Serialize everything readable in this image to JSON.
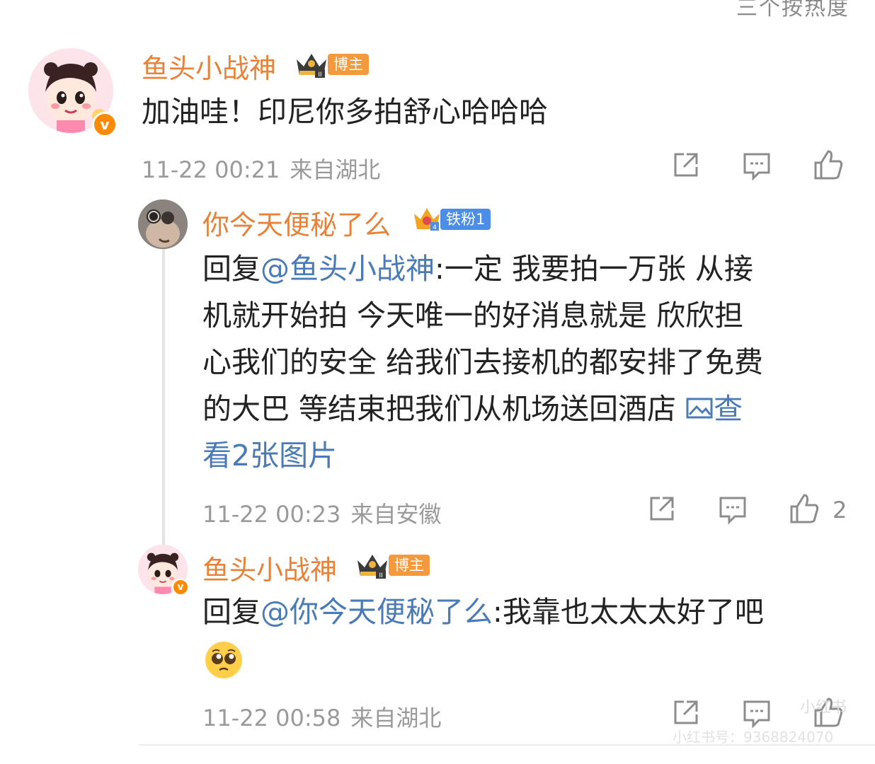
{
  "header": {
    "sort_cut_label": "三个按热度"
  },
  "comment": {
    "username": "鱼头小战神",
    "badge": "博主",
    "text": "加油哇！印尼你多拍舒心哈哈哈",
    "time": "11-22 00:21",
    "location": "来自湖北"
  },
  "reply1": {
    "username": "你今天便秘了么",
    "badge": "铁粉1",
    "reply_prefix": "回复",
    "mention": "@鱼头小战神",
    "text_line1": ":一定 我要拍一万张 从接",
    "text_line2": "机就开始拍 今天唯一的好消息就是 欣欣担",
    "text_line3": "心我们的安全 给我们去接机的都安排了免费",
    "text_line4": "的大巴 等结束把我们从机场送回酒店 ",
    "view_pics_a": "查",
    "view_pics_b": "看2张图片",
    "time": "11-22 00:23",
    "location": "来自安徽",
    "likes": "2"
  },
  "reply2": {
    "username": "鱼头小战神",
    "badge": "博主",
    "reply_prefix": "回复",
    "mention": "@你今天便秘了么",
    "text": ":我靠也太太太好了吧",
    "time": "11-22 00:58",
    "location": "来自湖北"
  },
  "watermark": {
    "logo_text": "小红书",
    "id_text": "小红书号：9368824070"
  },
  "colors": {
    "username": "#e8823a",
    "link": "#4a7bb7",
    "host_tag": "#f29a3d",
    "fan_tag": "#4c8de8"
  },
  "icons": [
    "share-icon",
    "comment-icon",
    "like-icon",
    "image-icon",
    "pleading-face-emoji",
    "crown-icon",
    "v-verified-icon"
  ]
}
